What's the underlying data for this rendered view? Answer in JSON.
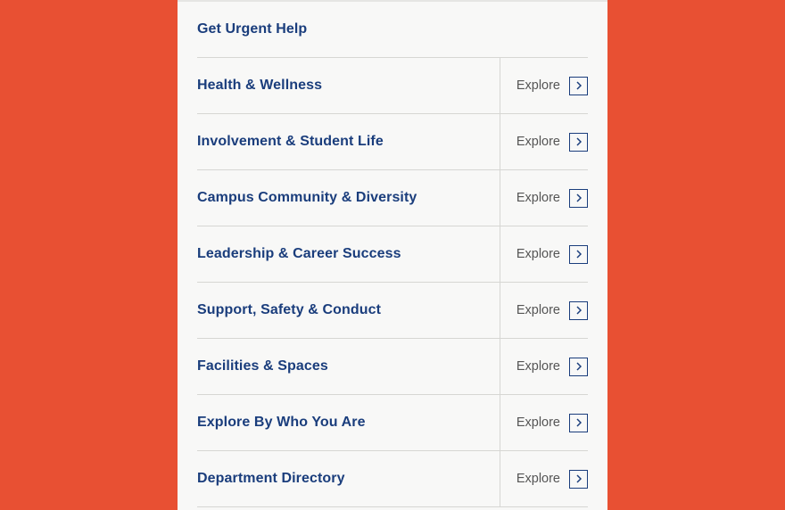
{
  "nav": {
    "explore_label": "Explore",
    "items": [
      {
        "label": "Get Urgent Help",
        "has_explore": false
      },
      {
        "label": "Health & Wellness",
        "has_explore": true
      },
      {
        "label": "Involvement & Student Life",
        "has_explore": true
      },
      {
        "label": "Campus Community & Diversity",
        "has_explore": true
      },
      {
        "label": "Leadership & Career Success",
        "has_explore": true
      },
      {
        "label": "Support, Safety & Conduct",
        "has_explore": true
      },
      {
        "label": "Facilities & Spaces",
        "has_explore": true
      },
      {
        "label": "Explore By Who You Are",
        "has_explore": true
      },
      {
        "label": "Department Directory",
        "has_explore": true
      }
    ]
  }
}
